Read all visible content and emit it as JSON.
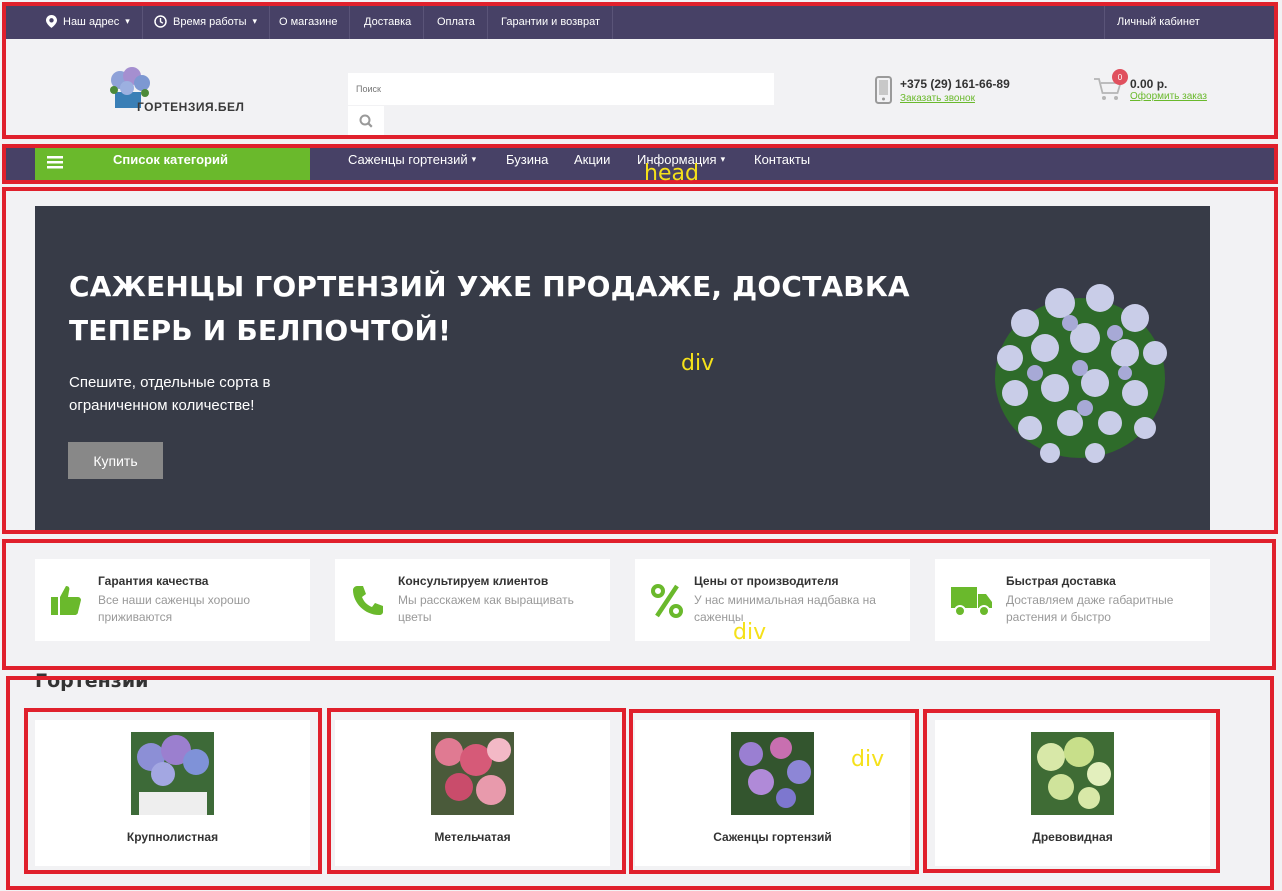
{
  "topbar": {
    "address": "Наш адрес",
    "hours": "Время работы",
    "about": "О магазине",
    "delivery": "Доставка",
    "payment": "Оплата",
    "guarantee": "Гарантии и возврат",
    "account": "Личный кабинет"
  },
  "header": {
    "logo_text": "ГОРТЕНЗИЯ.БЕЛ",
    "search_placeholder": "Поиск",
    "phone": "+375 (29) 161-66-89",
    "callback": "Заказать звонок",
    "cart_count": "0",
    "cart_total": "0.00 р.",
    "checkout": "Оформить заказ"
  },
  "nav": {
    "categories": "Список категорий",
    "items": [
      "Саженцы гортензий",
      "Бузина",
      "Акции",
      "Информация",
      "Контакты"
    ]
  },
  "hero": {
    "title": "САЖЕНЦЫ ГОРТЕНЗИЙ УЖЕ ПРОДАЖЕ, ДОСТАВКА ТЕПЕРЬ И БЕЛПОЧТОЙ!",
    "subtitle": "Спешите, отдельные сорта в ограниченном количестве!",
    "button": "Купить"
  },
  "features": [
    {
      "title": "Гарантия качества",
      "desc": "Все наши саженцы хорошо приживаются",
      "icon": "thumbs-up-icon"
    },
    {
      "title": "Консультируем клиентов",
      "desc": "Мы расскажем как выращивать цветы",
      "icon": "phone-icon"
    },
    {
      "title": "Цены от производителя",
      "desc": "У нас минимальная надбавка на саженцы",
      "icon": "percent-icon"
    },
    {
      "title": "Быстрая доставка",
      "desc": "Доставляем даже габаритные растения и быстро",
      "icon": "truck-icon"
    }
  ],
  "section_title": "Гортензии",
  "categories": [
    {
      "name": "Крупнолистная"
    },
    {
      "name": "Метельчатая"
    },
    {
      "name": "Саженцы гортензий"
    },
    {
      "name": "Древовидная"
    }
  ],
  "overlay_labels": {
    "head": "head",
    "div1": "div",
    "div2": "div",
    "div3": "div"
  },
  "colors": {
    "accent": "#6ab92c",
    "nav": "#474166",
    "hero": "#373b47",
    "annotation": "#e0202c"
  }
}
